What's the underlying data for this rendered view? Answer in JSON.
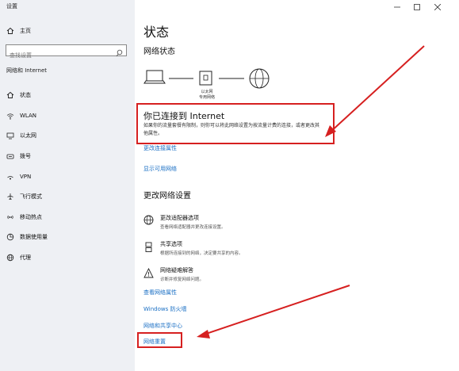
{
  "window": {
    "title": "设置"
  },
  "sidebar": {
    "home_label": "主页",
    "search_placeholder": "查找设置",
    "section_label": "网络和 Internet",
    "items": [
      {
        "label": "状态",
        "icon": "home-globe-icon"
      },
      {
        "label": "WLAN",
        "icon": "wifi-icon"
      },
      {
        "label": "以太网",
        "icon": "ethernet-icon"
      },
      {
        "label": "拨号",
        "icon": "phone-icon"
      },
      {
        "label": "VPN",
        "icon": "vpn-icon"
      },
      {
        "label": "飞行模式",
        "icon": "airplane-icon"
      },
      {
        "label": "移动热点",
        "icon": "hotspot-icon"
      },
      {
        "label": "数据使用量",
        "icon": "data-usage-icon"
      },
      {
        "label": "代理",
        "icon": "globe-icon"
      }
    ]
  },
  "main": {
    "page_title": "状态",
    "network_status_heading": "网络状态",
    "ethernet_label_line1": "以太网",
    "ethernet_label_line2": "专用网络",
    "connected_title": "你已连接到 Internet",
    "connected_desc": "如果你的流量套餐有限制，则你可以将此网络设置为按流量计费的连接，或者更改其他属性。",
    "link_change_properties": "更改连接属性",
    "link_show_networks": "显示可用网络",
    "change_settings_heading": "更改网络设置",
    "options": [
      {
        "title": "更改适配器选项",
        "desc": "查看网络适配器并更改连接设置。",
        "icon": "adapter-icon"
      },
      {
        "title": "共享选项",
        "desc": "根据所连接到的网络，决定要共享的内容。",
        "icon": "sharing-icon"
      },
      {
        "title": "网络疑难解答",
        "desc": "诊断并修复网络问题。",
        "icon": "warning-icon"
      }
    ],
    "link_view_properties": "查看网络属性",
    "link_firewall": "Windows 防火墙",
    "link_sharing_center": "网络和共享中心",
    "link_network_reset": "网络重置"
  },
  "colors": {
    "link": "#1a6fc4",
    "annotation_red": "#d62020",
    "sidebar_bg": "#eef0f4"
  }
}
